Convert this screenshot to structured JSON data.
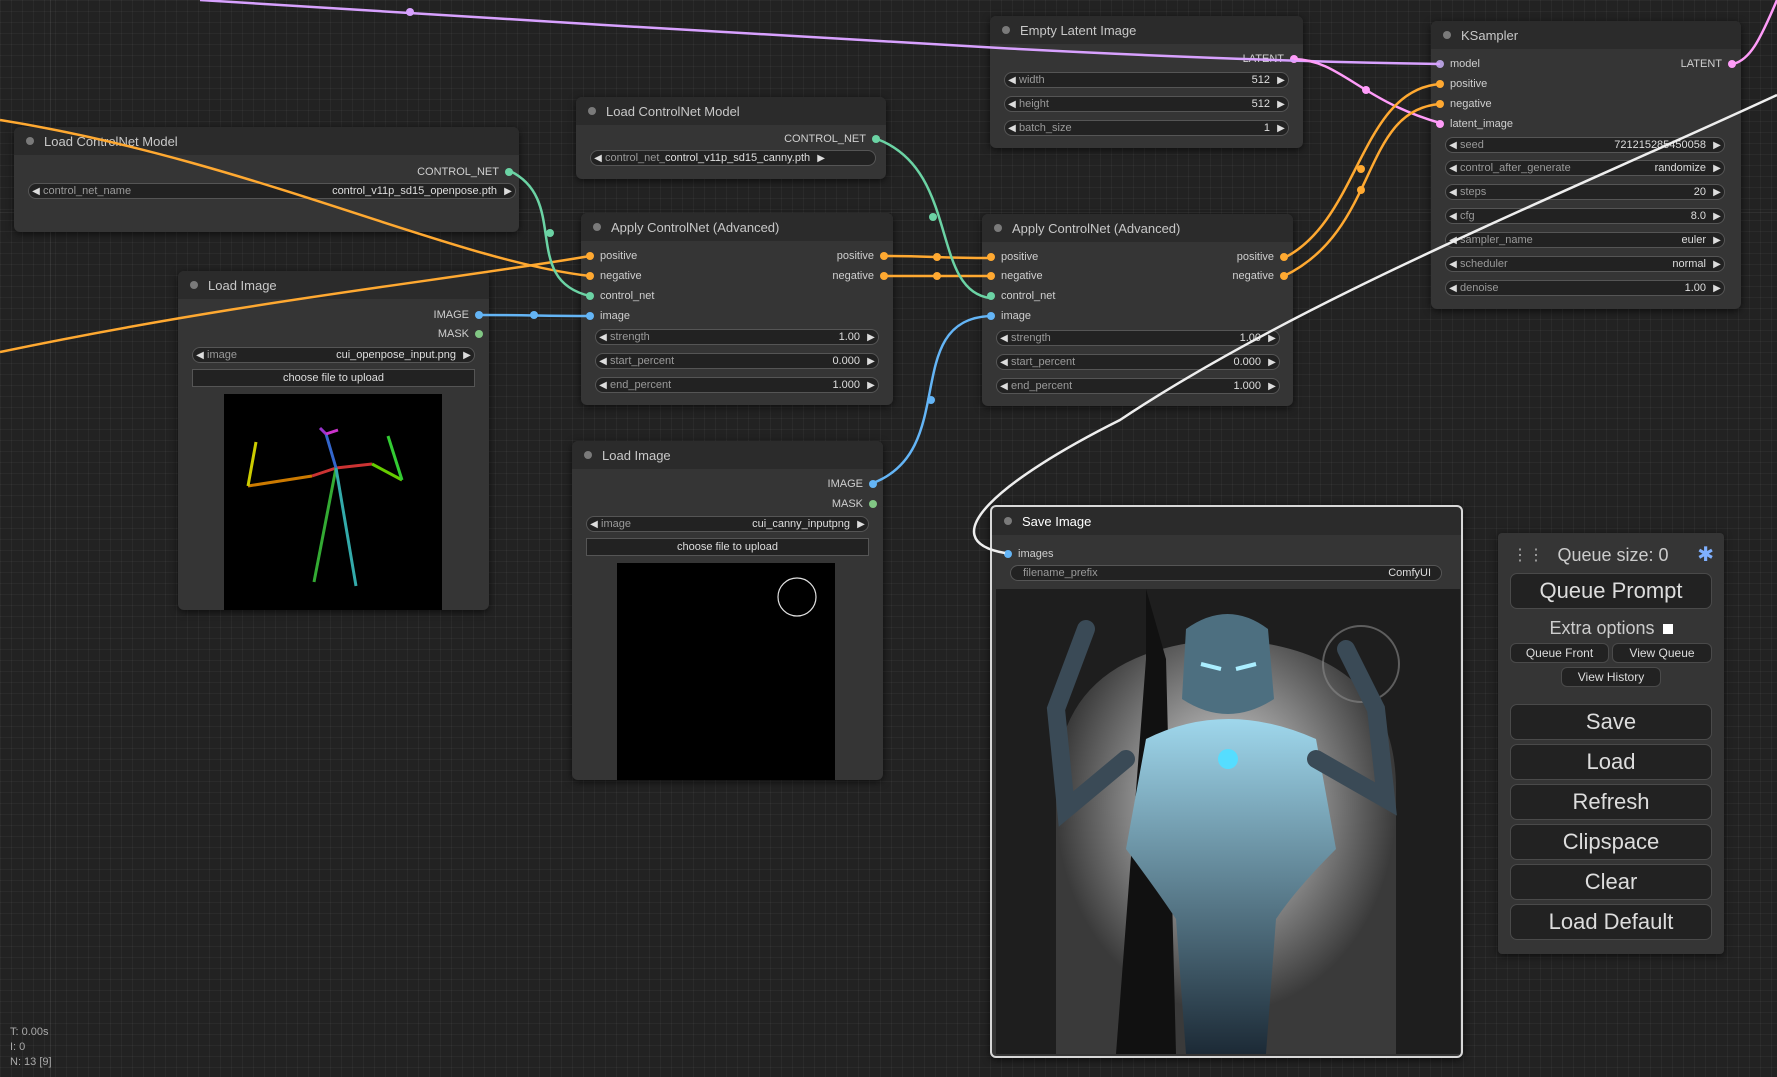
{
  "colors": {
    "canvas_bg": "#222222",
    "node_bg": "#353535",
    "node_title_bg": "#2b2b2b",
    "conditioning": "#ffa931",
    "control_net": "#6bd3a4",
    "image": "#64b5f6",
    "latent": "#ff9cf9",
    "model": "#b39ddb",
    "mask": "#81c784"
  },
  "nodes": {
    "load_controlnet_1": {
      "title": "Load ControlNet Model",
      "output": "CONTROL_NET",
      "widget": {
        "name": "control_net_name",
        "value": "control_v11p_sd15_openpose.pth"
      }
    },
    "load_controlnet_2": {
      "title": "Load ControlNet Model",
      "output": "CONTROL_NET",
      "widget": {
        "name": "control_net_name",
        "value": "control_v11p_sd15_canny.pth"
      }
    },
    "load_image_1": {
      "title": "Load Image",
      "outputs": [
        "IMAGE",
        "MASK"
      ],
      "widget": {
        "name": "image",
        "value": "cui_openpose_input.png"
      },
      "upload_label": "choose file to upload"
    },
    "load_image_2": {
      "title": "Load Image",
      "outputs": [
        "IMAGE",
        "MASK"
      ],
      "widget": {
        "name": "image",
        "value": "cui_canny_inputpng"
      },
      "upload_label": "choose file to upload"
    },
    "apply_controlnet_1": {
      "title": "Apply ControlNet (Advanced)",
      "inputs": [
        "positive",
        "negative",
        "control_net",
        "image"
      ],
      "outputs": [
        "positive",
        "negative"
      ],
      "widgets": [
        {
          "name": "strength",
          "value": "1.00"
        },
        {
          "name": "start_percent",
          "value": "0.000"
        },
        {
          "name": "end_percent",
          "value": "1.000"
        }
      ]
    },
    "apply_controlnet_2": {
      "title": "Apply ControlNet (Advanced)",
      "inputs": [
        "positive",
        "negative",
        "control_net",
        "image"
      ],
      "outputs": [
        "positive",
        "negative"
      ],
      "widgets": [
        {
          "name": "strength",
          "value": "1.00"
        },
        {
          "name": "start_percent",
          "value": "0.000"
        },
        {
          "name": "end_percent",
          "value": "1.000"
        }
      ]
    },
    "empty_latent": {
      "title": "Empty Latent Image",
      "output": "LATENT",
      "widgets": [
        {
          "name": "width",
          "value": "512"
        },
        {
          "name": "height",
          "value": "512"
        },
        {
          "name": "batch_size",
          "value": "1"
        }
      ]
    },
    "ksampler": {
      "title": "KSampler",
      "inputs": [
        "model",
        "positive",
        "negative",
        "latent_image"
      ],
      "output": "LATENT",
      "widgets": [
        {
          "name": "seed",
          "value": "721215285450058"
        },
        {
          "name": "control_after_generate",
          "value": "randomize"
        },
        {
          "name": "steps",
          "value": "20"
        },
        {
          "name": "cfg",
          "value": "8.0"
        },
        {
          "name": "sampler_name",
          "value": "euler"
        },
        {
          "name": "scheduler",
          "value": "normal"
        },
        {
          "name": "denoise",
          "value": "1.00"
        }
      ]
    },
    "save_image": {
      "title": "Save Image",
      "input": "images",
      "widget": {
        "name": "filename_prefix",
        "value": "ComfyUI"
      }
    }
  },
  "queue_panel": {
    "queue_size": "Queue size: 0",
    "queue_prompt": "Queue Prompt",
    "extra_options": "Extra options",
    "queue_front": "Queue Front",
    "view_queue": "View Queue",
    "view_history": "View History",
    "buttons": [
      "Save",
      "Load",
      "Refresh",
      "Clipspace",
      "Clear",
      "Load Default"
    ]
  },
  "stats": [
    "T: 0.00s",
    "I: 0",
    "N: 13 [9]"
  ]
}
